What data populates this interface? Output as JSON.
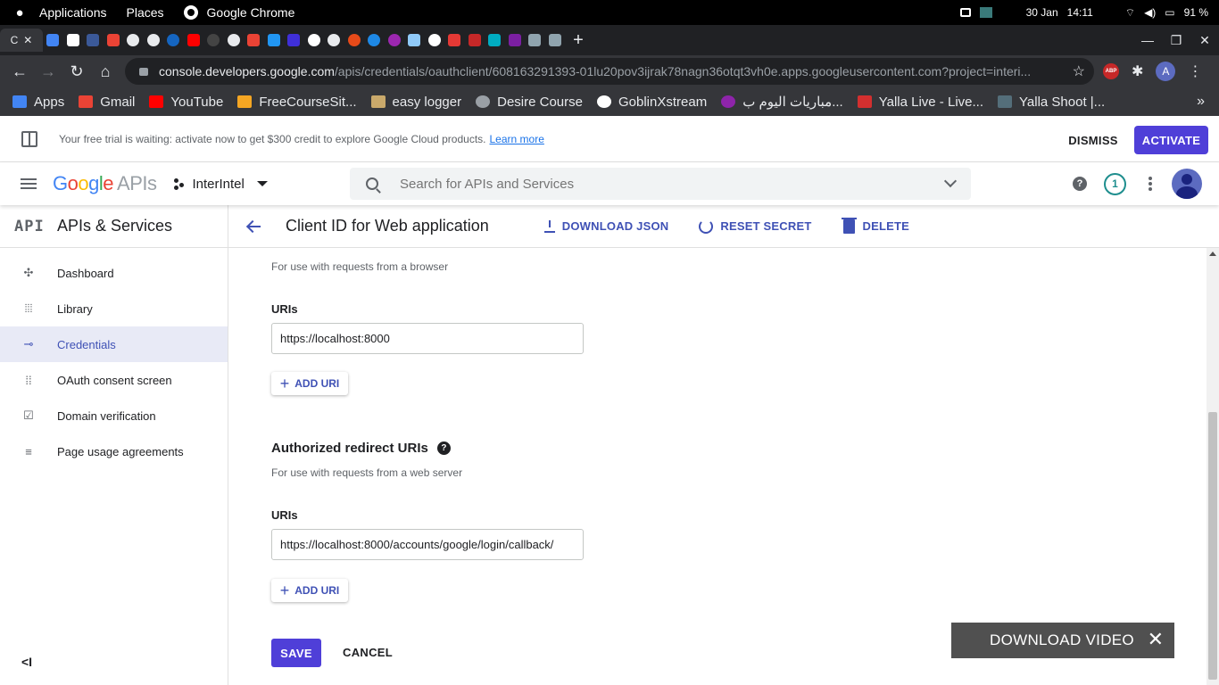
{
  "os": {
    "menus": [
      "Applications",
      "Places"
    ],
    "app_name": "Google Chrome",
    "date": "30 Jan",
    "time": "14:11",
    "battery": "91 %"
  },
  "browser": {
    "active_tab_letter": "C",
    "url_host": "console.developers.google.com",
    "url_path": "/apis/credentials/oauthclient/608163291393-01lu20pov3ijrak78nagn36otqt3vh0e.apps.googleusercontent.com?project=interi...",
    "profile_initial": "A",
    "abp_count": "1",
    "bookmarks": [
      {
        "label": "Apps",
        "color": "#4285f4"
      },
      {
        "label": "Gmail",
        "color": "#ea4335"
      },
      {
        "label": "YouTube",
        "color": "#ff0000"
      },
      {
        "label": "FreeCourseSit...",
        "color": "#f5a623"
      },
      {
        "label": "easy logger",
        "color": "#c9a96b"
      },
      {
        "label": "Desire Course",
        "color": "#9aa0a6"
      },
      {
        "label": "GoblinXstream",
        "color": "#ffffff"
      },
      {
        "label": "مباريات اليوم ب...",
        "color": "#8e24aa"
      },
      {
        "label": "Yalla Live - Live...",
        "color": "#d32f2f"
      },
      {
        "label": "Yalla Shoot |...",
        "color": "#546e7a"
      }
    ],
    "bookmarks_more": "»"
  },
  "banner": {
    "text": "Your free trial is waiting: activate now to get $300 credit to explore Google Cloud products.",
    "link": "Learn more",
    "dismiss": "DISMISS",
    "activate": "ACTIVATE"
  },
  "header": {
    "logo_google": "Google",
    "logo_apis": "APIs",
    "project": "InterIntel",
    "search_placeholder": "Search for APIs and Services",
    "help": "?",
    "notifications": "1"
  },
  "sidebar": {
    "logo": "API",
    "title": "APIs & Services",
    "items": [
      {
        "label": "Dashboard",
        "icon": "dashboard-icon"
      },
      {
        "label": "Library",
        "icon": "library-icon"
      },
      {
        "label": "Credentials",
        "icon": "key-icon",
        "active": true
      },
      {
        "label": "OAuth consent screen",
        "icon": "consent-icon"
      },
      {
        "label": "Domain verification",
        "icon": "check-box-icon"
      },
      {
        "label": "Page usage agreements",
        "icon": "settings-list-icon"
      }
    ],
    "collapse": "<I"
  },
  "page": {
    "title": "Client ID for Web application",
    "download_json": "DOWNLOAD JSON",
    "reset_secret": "RESET SECRET",
    "delete": "DELETE",
    "origins_sub": "For use with requests from a browser",
    "origins_uris_label": "URIs",
    "origins_uri_value": "https://localhost:8000",
    "add_uri": "ADD URI",
    "redirect_title": "Authorized redirect URIs",
    "redirect_help": "?",
    "redirect_sub": "For use with requests from a web server",
    "redirect_uris_label": "URIs",
    "redirect_uri_value": "https://localhost:8000/accounts/google/login/callback/",
    "save": "SAVE",
    "cancel": "CANCEL"
  },
  "overlay": {
    "label": "DOWNLOAD VIDEO",
    "close": "✕"
  },
  "colors": {
    "accent": "#4f3fd8",
    "link": "#3f51b5",
    "active_nav_bg": "#e8eaf6"
  }
}
